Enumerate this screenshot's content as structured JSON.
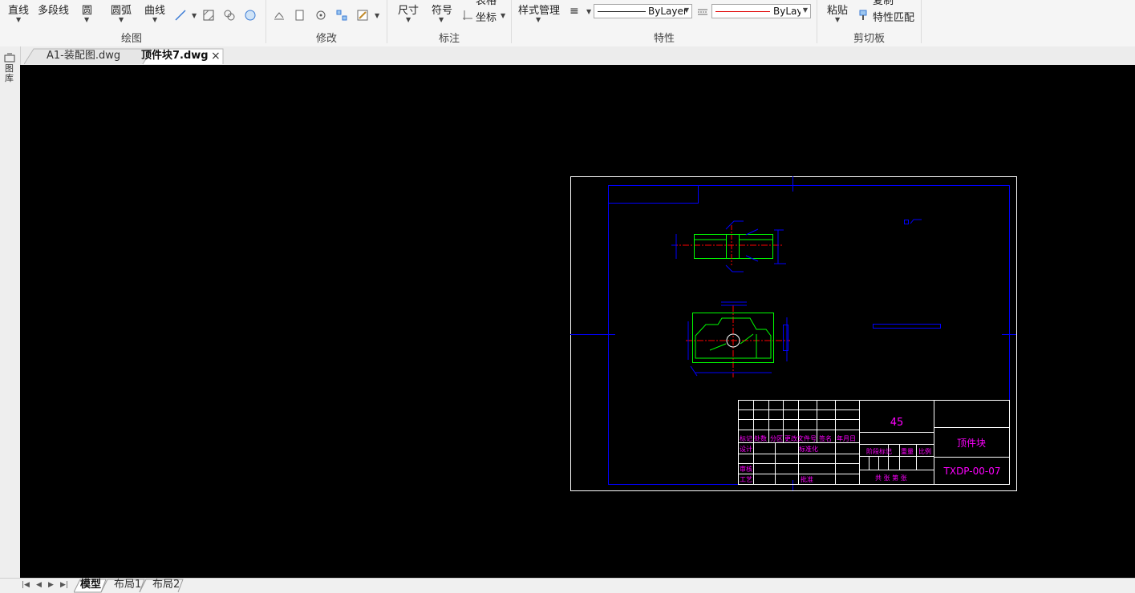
{
  "ribbon": {
    "draw": {
      "line": "直线",
      "polyline": "多段线",
      "circle": "圆",
      "arc": "圆弧",
      "curve": "曲线",
      "group": "绘图"
    },
    "modify": {
      "group": "修改"
    },
    "annotate": {
      "dimension": "尺寸",
      "symbol": "符号",
      "table": "表格",
      "coordinate": "坐标",
      "group": "标注"
    },
    "properties": {
      "style_manager": "样式管理",
      "linetype": "ByLayer",
      "lineweight": "ByLayer",
      "group": "特性"
    },
    "clipboard": {
      "paste": "粘贴",
      "copy": "复制",
      "match_properties": "特性匹配",
      "group": "剪切板"
    }
  },
  "tabs": [
    {
      "label": "A1-装配图.dwg",
      "active": false
    },
    {
      "label": "顶件块7.dwg",
      "active": true
    }
  ],
  "tab_close": "×",
  "sidebar": {
    "label": "图库"
  },
  "layout_tabs": [
    {
      "label": "模型",
      "active": true
    },
    {
      "label": "布局1",
      "active": false
    },
    {
      "label": "布局2",
      "active": false
    }
  ],
  "nav_arrows": [
    "|◀",
    "◀",
    "▶",
    "▶|"
  ],
  "title_block": {
    "material": "45",
    "part_name": "顶件块",
    "drawing_no": "TXDP-00-07",
    "col_headers": [
      "标记",
      "处数",
      "分区",
      "更改文件号",
      "签名",
      "年月日"
    ],
    "design": "设计",
    "standardize": "标准化",
    "stage_mark": "阶段标记",
    "weight": "重量",
    "scale": "比例",
    "review": "审核",
    "process": "工艺",
    "approve": "批准",
    "sheets": "共 张 第 张"
  },
  "colors": {
    "canvas": "#000000",
    "frame_outer": "#ffffff",
    "frame_inner": "#0000ff",
    "title_text": "#ff00ff",
    "geometry": "#00ff00",
    "centerline": "#ff0000",
    "dimension": "#0000ff"
  }
}
